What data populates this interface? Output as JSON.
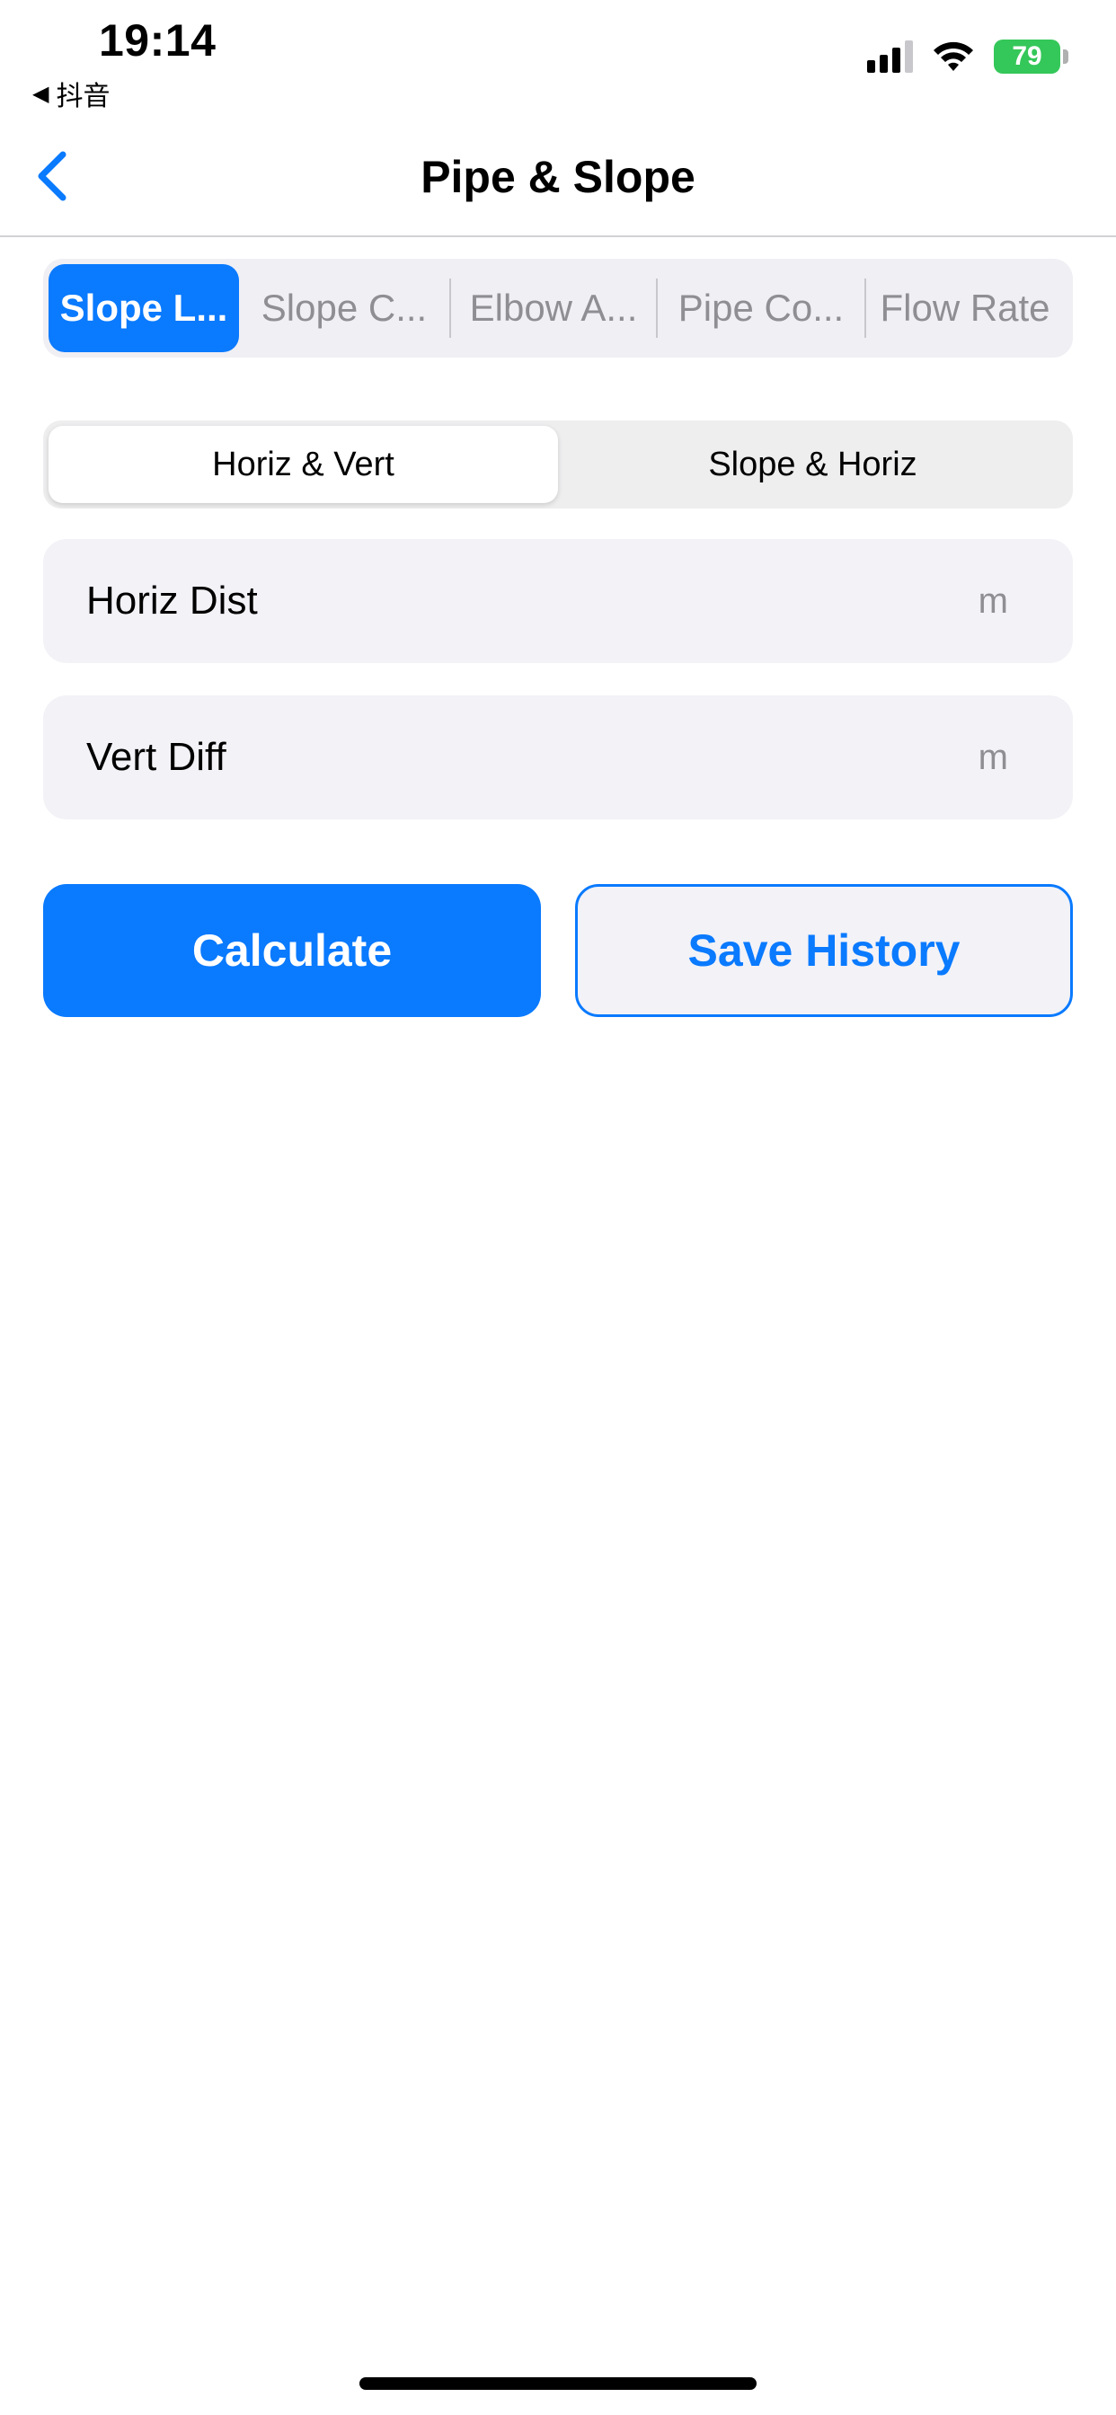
{
  "status_bar": {
    "time": "19:14",
    "back_app": "抖音",
    "battery": "79"
  },
  "nav": {
    "title": "Pipe & Slope",
    "back_icon": "chevron-left-icon"
  },
  "tabs": [
    {
      "label": "Slope L...",
      "active": true
    },
    {
      "label": "Slope C...",
      "active": false
    },
    {
      "label": "Elbow A...",
      "active": false
    },
    {
      "label": "Pipe Co...",
      "active": false
    },
    {
      "label": "Flow Rate",
      "active": false
    }
  ],
  "mode": {
    "options": [
      "Horiz & Vert",
      "Slope & Horiz"
    ],
    "selected": "Horiz & Vert"
  },
  "fields": [
    {
      "label": "Horiz Dist",
      "value": "",
      "unit": "m"
    },
    {
      "label": "Vert Diff",
      "value": "",
      "unit": "m"
    }
  ],
  "actions": {
    "calculate": "Calculate",
    "save_history": "Save History"
  },
  "colors": {
    "accent": "#0a7aff",
    "battery": "#34c759"
  }
}
